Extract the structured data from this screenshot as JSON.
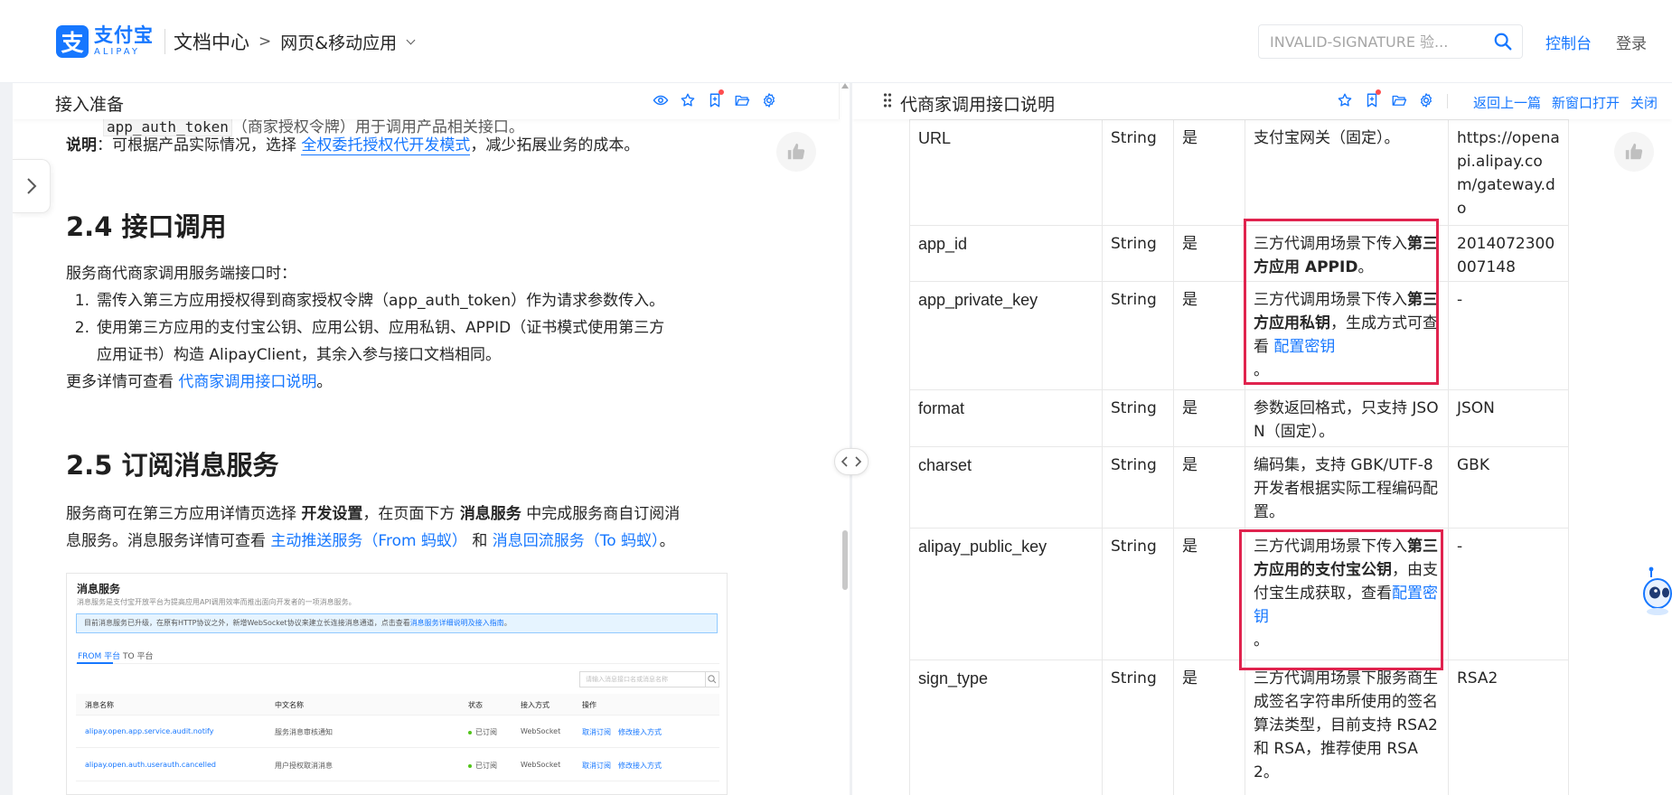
{
  "header": {
    "logo_cn": "支付宝",
    "logo_en": "ALIPAY",
    "doc_center": "文档中心",
    "crumb_arrow": ">",
    "crumb_page": "网页&移动应用",
    "search_placeholder": "INVALID-SIGNATURE 验...",
    "console": "控制台",
    "login": "登录"
  },
  "left_panel": {
    "title": "接入准备",
    "peek_code": "app_auth_token",
    "peek_text": "（商家授权令牌）用于调用产品相关接口。",
    "note_label": "说明",
    "note_text_before": "：可根据产品实际情况，选择 ",
    "note_link": "全权委托授权代开发模式",
    "note_text_after": "，减少拓展业务的成本。",
    "section_24": "2.4 接口调用",
    "intro_24": "服务商代商家调用服务端接口时：",
    "list_24": [
      {
        "num": "1.",
        "text": "需传入第三方应用授权得到商家授权令牌（app_auth_token）作为请求参数传入。"
      },
      {
        "num": "2.",
        "text": "使用第三方应用的支付宝公钥、应用公钥、应用私钥、APPID（证书模式使用第三方"
      },
      {
        "num": "",
        "text": "应用证书）构造 AlipayClient，其余入参与接口文档相同。"
      }
    ],
    "more_before": "更多详情可查看 ",
    "more_link": "代商家调用接口说明",
    "more_after": "。",
    "section_25": "2.5 订阅消息服务",
    "p25_a": "服务商可在第三方应用详情页选择 ",
    "p25_b1": "开发设置",
    "p25_c": "，在页面下方 ",
    "p25_b2": "消息服务",
    "p25_d": " 中完成服务商自订阅消",
    "p25_e": "息服务。消息服务详情可查看 ",
    "p25_link1": "主动推送服务（From 蚂蚁）",
    "p25_f": " 和 ",
    "p25_link2": "消息回流服务（To 蚂蚁）",
    "p25_g": "。",
    "screenshot": {
      "title": "消息服务",
      "desc": "消息服务是支付宝开放平台为提高应用API调用效率而推出面向开发者的一项消息服务。",
      "notice_text": "目前消息服务已升级，在原有HTTP协议之外，新增WebSocket协议来建立长连接消息通道，点击查看",
      "notice_link": "消息服务详细说明及接入指南",
      "notice_end": "。",
      "tab_from": "FROM 平台",
      "tab_to": "TO 平台",
      "search_placeholder": "请输入消息接口名或消息名称",
      "columns": [
        "消息名称",
        "中文名称",
        "状态",
        "接入方式",
        "操作"
      ],
      "rows": [
        {
          "name": "alipay.open.app.service.audit.notify",
          "cn": "服务消息审核通知",
          "status": "已订阅",
          "method": "WebSocket",
          "op1": "取消订阅",
          "op2": "修改接入方式"
        },
        {
          "name": "alipay.open.auth.userauth.cancelled",
          "cn": "用户授权取消消息",
          "status": "已订阅",
          "method": "WebSocket",
          "op1": "取消订阅",
          "op2": "修改接入方式"
        }
      ]
    }
  },
  "right_panel": {
    "title": "代商家调用接口说明",
    "back_link": "返回上一篇",
    "new_window_link": "新窗口打开",
    "close_link": "关闭",
    "rows": [
      {
        "param": "URL",
        "type": "String",
        "required": "是",
        "desc_plain": "支付宝网关（固定）。",
        "value": "https://openapi.alipay.com/gateway.do"
      },
      {
        "param": "app_id",
        "type": "String",
        "required": "是",
        "desc_a": "三方代调用场景下传入",
        "desc_b": "第三方应用 APPID",
        "desc_c": "。",
        "value": "2014072300007148"
      },
      {
        "param": "app_private_key",
        "type": "String",
        "required": "是",
        "desc_a": "三方代调用场景下传入",
        "desc_b": "第三方应用私钥",
        "desc_c": "，生成方式可查看 ",
        "desc_link": "配置密钥",
        "desc_d": "。",
        "value": "-"
      },
      {
        "param": "format",
        "type": "String",
        "required": "是",
        "desc_plain": "参数返回格式，只支持 JSON（固定）。",
        "value": "JSON"
      },
      {
        "param": "charset",
        "type": "String",
        "required": "是",
        "desc_plain": "编码集，支持 GBK/UTF-8 开发者根据实际工程编码配置。",
        "value": "GBK"
      },
      {
        "param": "alipay_public_key",
        "type": "String",
        "required": "是",
        "desc_a": "三方代调用场景下传入",
        "desc_b": "第三方应用的支付宝公钥",
        "desc_c": "，由支付宝生成获取，查看",
        "desc_link": "配置密钥",
        "desc_d": "。",
        "value": "-"
      },
      {
        "param": "sign_type",
        "type": "String",
        "required": "是",
        "desc_plain": "三方代调用场景下服务商生成签名字符串所使用的签名算法类型，目前支持 RSA2 和 RSA，推荐使用 RSA2。",
        "value": "RSA2"
      }
    ]
  },
  "colors": {
    "brand": "#1677ff",
    "highlight": "#e0234e",
    "dot": "#ff4d4f"
  }
}
